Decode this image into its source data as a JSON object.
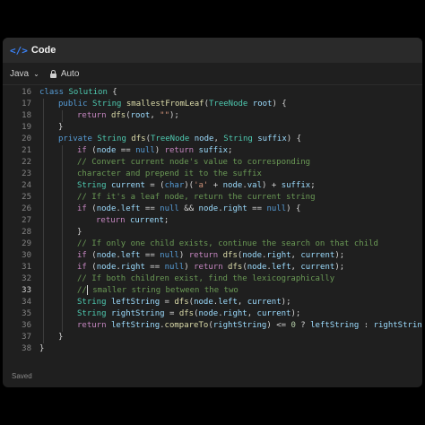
{
  "header": {
    "icon": "code-icon",
    "title": "Code"
  },
  "toolbar": {
    "language": "Java",
    "mode": "Auto"
  },
  "status": "Saved",
  "editor": {
    "active_line": 33,
    "lines": [
      {
        "n": 16,
        "indent": 0,
        "tokens": [
          [
            "kw",
            "class "
          ],
          [
            "ty",
            "Solution"
          ],
          [
            "pl",
            " {"
          ]
        ]
      },
      {
        "n": 17,
        "indent": 1,
        "tokens": [
          [
            "kw",
            "public "
          ],
          [
            "ty",
            "String "
          ],
          [
            "fn",
            "smallestFromLeaf"
          ],
          [
            "pl",
            "("
          ],
          [
            "ty",
            "TreeNode "
          ],
          [
            "var",
            "root"
          ],
          [
            "pl",
            ") {"
          ]
        ]
      },
      {
        "n": 18,
        "indent": 2,
        "tokens": [
          [
            "ctl",
            "return "
          ],
          [
            "fn",
            "dfs"
          ],
          [
            "pl",
            "("
          ],
          [
            "var",
            "root"
          ],
          [
            "pl",
            ", "
          ],
          [
            "str",
            "\"\""
          ],
          [
            "pl",
            ");"
          ]
        ]
      },
      {
        "n": 19,
        "indent": 1,
        "tokens": [
          [
            "pl",
            "}"
          ]
        ]
      },
      {
        "n": 20,
        "indent": 1,
        "tokens": [
          [
            "kw",
            "private "
          ],
          [
            "ty",
            "String "
          ],
          [
            "fn",
            "dfs"
          ],
          [
            "pl",
            "("
          ],
          [
            "ty",
            "TreeNode "
          ],
          [
            "var",
            "node"
          ],
          [
            "pl",
            ", "
          ],
          [
            "ty",
            "String "
          ],
          [
            "var",
            "suffix"
          ],
          [
            "pl",
            ") {"
          ]
        ]
      },
      {
        "n": 21,
        "indent": 2,
        "tokens": [
          [
            "ctl",
            "if "
          ],
          [
            "pl",
            "("
          ],
          [
            "var",
            "node"
          ],
          [
            "pl",
            " == "
          ],
          [
            "kw",
            "null"
          ],
          [
            "pl",
            ") "
          ],
          [
            "ctl",
            "return "
          ],
          [
            "var",
            "suffix"
          ],
          [
            "pl",
            ";"
          ]
        ]
      },
      {
        "n": 22,
        "indent": 2,
        "tokens": [
          [
            "cm",
            "// Convert current node's value to corresponding"
          ]
        ]
      },
      {
        "n": 23,
        "indent": 2,
        "tokens": [
          [
            "cm",
            "character and prepend it to the suffix"
          ]
        ]
      },
      {
        "n": 24,
        "indent": 2,
        "tokens": [
          [
            "ty",
            "String "
          ],
          [
            "var",
            "current"
          ],
          [
            "pl",
            " = ("
          ],
          [
            "kw",
            "char"
          ],
          [
            "pl",
            ")("
          ],
          [
            "str",
            "'a'"
          ],
          [
            "pl",
            " + "
          ],
          [
            "var",
            "node"
          ],
          [
            "pl",
            "."
          ],
          [
            "var",
            "val"
          ],
          [
            "pl",
            ") + "
          ],
          [
            "var",
            "suffix"
          ],
          [
            "pl",
            ";"
          ]
        ]
      },
      {
        "n": 25,
        "indent": 2,
        "tokens": [
          [
            "cm",
            "// If it's a leaf node, return the current string"
          ]
        ]
      },
      {
        "n": 26,
        "indent": 2,
        "tokens": [
          [
            "ctl",
            "if "
          ],
          [
            "pl",
            "("
          ],
          [
            "var",
            "node"
          ],
          [
            "pl",
            "."
          ],
          [
            "var",
            "left"
          ],
          [
            "pl",
            " == "
          ],
          [
            "kw",
            "null"
          ],
          [
            "pl",
            " && "
          ],
          [
            "var",
            "node"
          ],
          [
            "pl",
            "."
          ],
          [
            "var",
            "right"
          ],
          [
            "pl",
            " == "
          ],
          [
            "kw",
            "null"
          ],
          [
            "pl",
            ") {"
          ]
        ]
      },
      {
        "n": 27,
        "indent": 3,
        "tokens": [
          [
            "ctl",
            "return "
          ],
          [
            "var",
            "current"
          ],
          [
            "pl",
            ";"
          ]
        ]
      },
      {
        "n": 28,
        "indent": 2,
        "tokens": [
          [
            "pl",
            "}"
          ]
        ]
      },
      {
        "n": 29,
        "indent": 2,
        "tokens": [
          [
            "cm",
            "// If only one child exists, continue the search on that child"
          ]
        ]
      },
      {
        "n": 30,
        "indent": 2,
        "tokens": [
          [
            "ctl",
            "if "
          ],
          [
            "pl",
            "("
          ],
          [
            "var",
            "node"
          ],
          [
            "pl",
            "."
          ],
          [
            "var",
            "left"
          ],
          [
            "pl",
            " == "
          ],
          [
            "kw",
            "null"
          ],
          [
            "pl",
            ") "
          ],
          [
            "ctl",
            "return "
          ],
          [
            "fn",
            "dfs"
          ],
          [
            "pl",
            "("
          ],
          [
            "var",
            "node"
          ],
          [
            "pl",
            "."
          ],
          [
            "var",
            "right"
          ],
          [
            "pl",
            ", "
          ],
          [
            "var",
            "current"
          ],
          [
            "pl",
            ");"
          ]
        ]
      },
      {
        "n": 31,
        "indent": 2,
        "tokens": [
          [
            "ctl",
            "if "
          ],
          [
            "pl",
            "("
          ],
          [
            "var",
            "node"
          ],
          [
            "pl",
            "."
          ],
          [
            "var",
            "right"
          ],
          [
            "pl",
            " == "
          ],
          [
            "kw",
            "null"
          ],
          [
            "pl",
            ") "
          ],
          [
            "ctl",
            "return "
          ],
          [
            "fn",
            "dfs"
          ],
          [
            "pl",
            "("
          ],
          [
            "var",
            "node"
          ],
          [
            "pl",
            "."
          ],
          [
            "var",
            "left"
          ],
          [
            "pl",
            ", "
          ],
          [
            "var",
            "current"
          ],
          [
            "pl",
            ");"
          ]
        ]
      },
      {
        "n": 32,
        "indent": 2,
        "tokens": [
          [
            "cm",
            "// If both children exist, find the lexicographically"
          ]
        ]
      },
      {
        "n": 33,
        "indent": 2,
        "tokens": [
          [
            "cm",
            "//"
          ],
          [
            "cursor",
            ""
          ],
          [
            "cm",
            " smaller string between the two"
          ]
        ]
      },
      {
        "n": 34,
        "indent": 2,
        "tokens": [
          [
            "ty",
            "String "
          ],
          [
            "var",
            "leftString"
          ],
          [
            "pl",
            " = "
          ],
          [
            "fn",
            "dfs"
          ],
          [
            "pl",
            "("
          ],
          [
            "var",
            "node"
          ],
          [
            "pl",
            "."
          ],
          [
            "var",
            "left"
          ],
          [
            "pl",
            ", "
          ],
          [
            "var",
            "current"
          ],
          [
            "pl",
            ");"
          ]
        ]
      },
      {
        "n": 35,
        "indent": 2,
        "tokens": [
          [
            "ty",
            "String "
          ],
          [
            "var",
            "rightString"
          ],
          [
            "pl",
            " = "
          ],
          [
            "fn",
            "dfs"
          ],
          [
            "pl",
            "("
          ],
          [
            "var",
            "node"
          ],
          [
            "pl",
            "."
          ],
          [
            "var",
            "right"
          ],
          [
            "pl",
            ", "
          ],
          [
            "var",
            "current"
          ],
          [
            "pl",
            ");"
          ]
        ]
      },
      {
        "n": 36,
        "indent": 2,
        "tokens": [
          [
            "ctl",
            "return "
          ],
          [
            "var",
            "leftString"
          ],
          [
            "pl",
            "."
          ],
          [
            "fn",
            "compareTo"
          ],
          [
            "pl",
            "("
          ],
          [
            "var",
            "rightString"
          ],
          [
            "pl",
            ") <= "
          ],
          [
            "num",
            "0"
          ],
          [
            "pl",
            " ? "
          ],
          [
            "var",
            "leftString"
          ],
          [
            "pl",
            " : "
          ],
          [
            "var",
            "rightString"
          ],
          [
            "pl",
            ";"
          ]
        ]
      },
      {
        "n": 37,
        "indent": 1,
        "tokens": [
          [
            "pl",
            "}"
          ]
        ]
      },
      {
        "n": 38,
        "indent": 0,
        "tokens": [
          [
            "pl",
            "}"
          ]
        ]
      }
    ]
  }
}
